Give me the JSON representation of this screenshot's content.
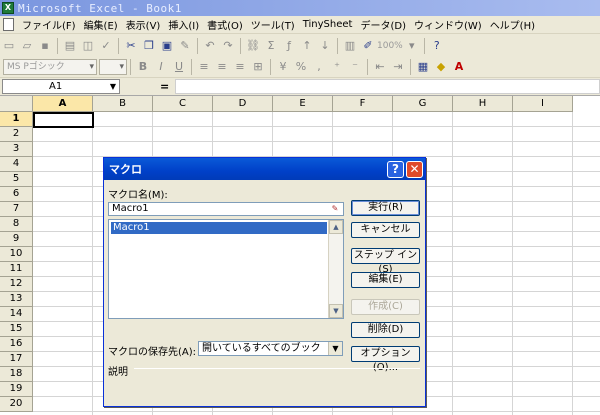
{
  "window": {
    "title": "Microsoft Excel - Book1",
    "icon": "excel-app-icon"
  },
  "menubar": {
    "items": [
      "ファイル(F)",
      "編集(E)",
      "表示(V)",
      "挿入(I)",
      "書式(O)",
      "ツール(T)",
      "TinySheet",
      "データ(D)",
      "ウィンドウ(W)",
      "ヘルプ(H)"
    ]
  },
  "toolbar": {
    "zoom": "100%",
    "font_name": "MS Pゴシック"
  },
  "formula_bar": {
    "name_box": "A1",
    "equals": "="
  },
  "grid": {
    "columns": [
      "A",
      "B",
      "C",
      "D",
      "E",
      "F",
      "G",
      "H",
      "I"
    ],
    "rows": [
      "1",
      "2",
      "3",
      "4",
      "5",
      "6",
      "7",
      "8",
      "9",
      "10",
      "11",
      "12",
      "13",
      "14",
      "15",
      "16",
      "17",
      "18",
      "19",
      "20"
    ],
    "active_cell": "A1"
  },
  "dialog": {
    "title": "マクロ",
    "macro_name_label": "マクロ名(M):",
    "macro_name_value": "Macro1",
    "macro_list": [
      "Macro1"
    ],
    "buttons": {
      "run": "実行(R)",
      "cancel": "キャンセル",
      "step_into": "ステップ イン(S)",
      "edit": "編集(E)",
      "create": "作成(C)",
      "delete": "削除(D)",
      "options": "オプション(O)..."
    },
    "save_in_label": "マクロの保存先(A):",
    "save_in_value": "開いているすべてのブック",
    "description_label": "説明"
  }
}
